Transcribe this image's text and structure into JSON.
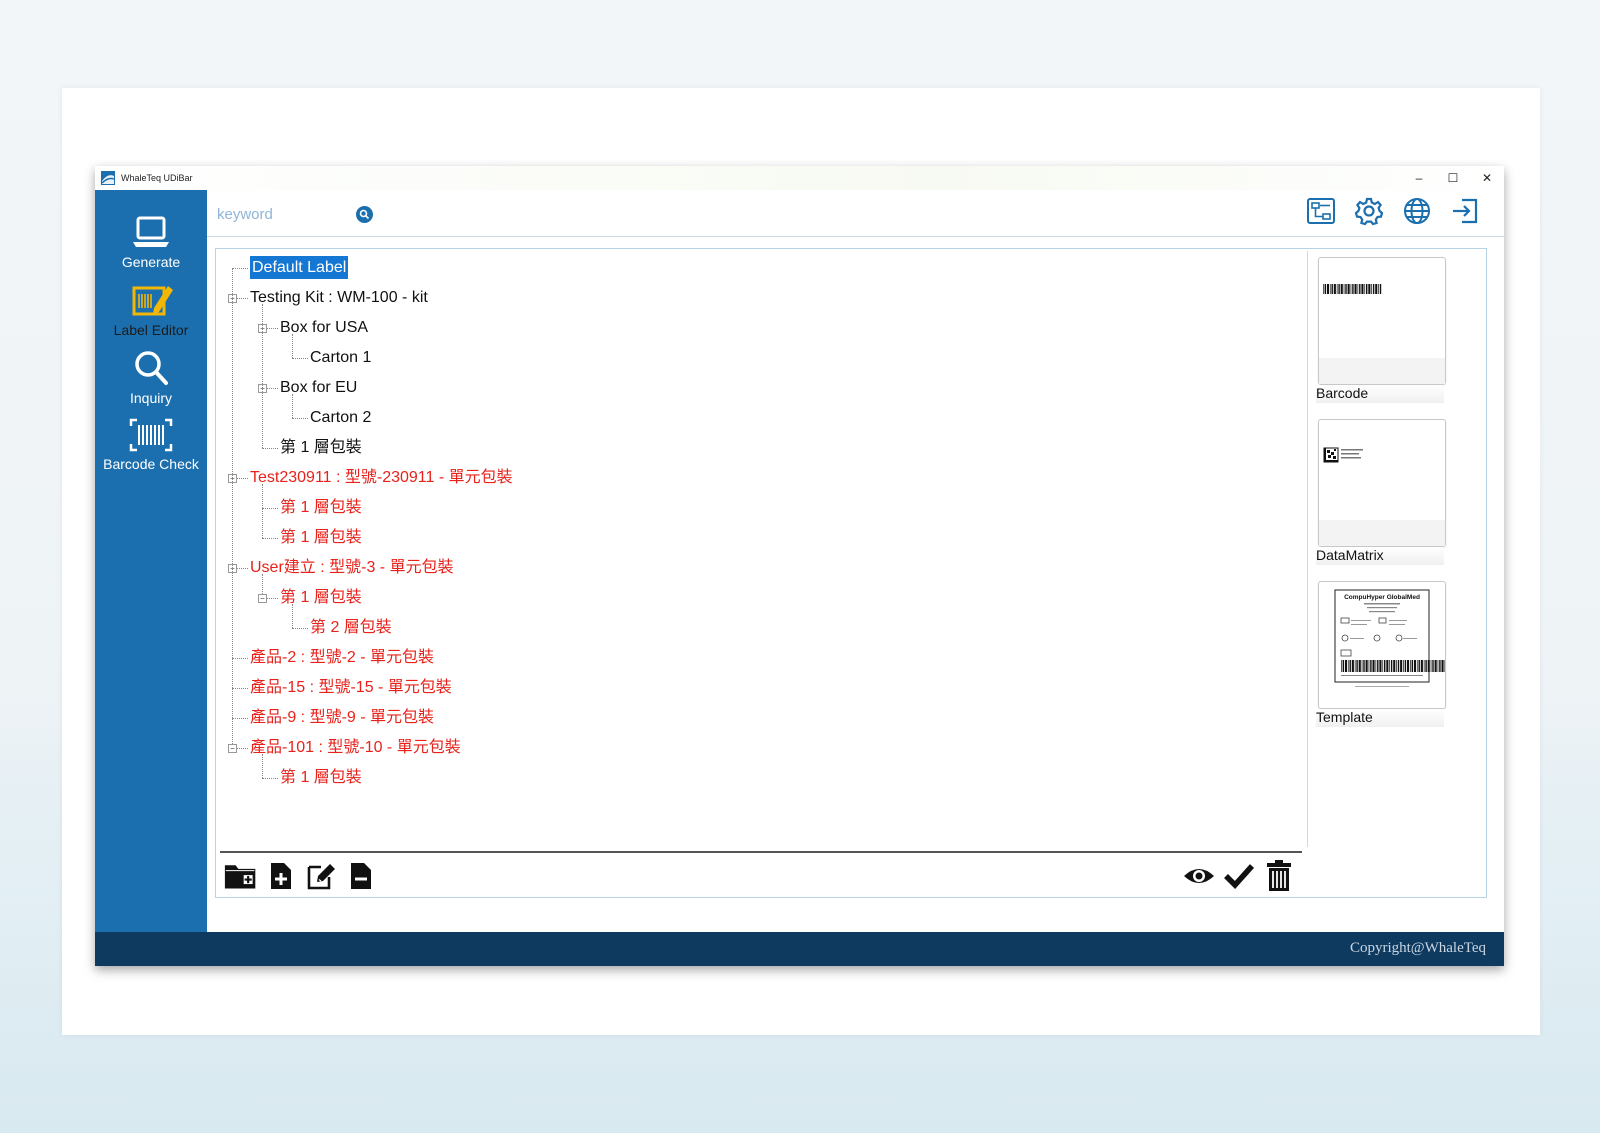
{
  "window": {
    "title": "WhaleTeq UDiBar",
    "controls": [
      "–",
      "☐",
      "✕"
    ]
  },
  "sidebar": {
    "items": [
      {
        "label": "Generate",
        "icon": "laptop-icon"
      },
      {
        "label": "Label Editor",
        "icon": "label-edit-icon"
      },
      {
        "label": "Inquiry",
        "icon": "magnifier-icon"
      },
      {
        "label": "Barcode Check",
        "icon": "barcode-scan-icon"
      }
    ]
  },
  "search": {
    "placeholder": "keyword"
  },
  "toolbar": {
    "icons": [
      "flow-chart-icon",
      "gear-icon",
      "globe-icon",
      "logout-icon"
    ]
  },
  "tree": {
    "nodes": [
      {
        "label": "Default Label",
        "level": 0,
        "color": "black",
        "selected": true
      },
      {
        "label": "Testing Kit : WM-100 - kit",
        "level": 0,
        "color": "black"
      },
      {
        "label": "Box for USA",
        "level": 1,
        "color": "black"
      },
      {
        "label": "Carton 1",
        "level": 2,
        "color": "black"
      },
      {
        "label": "Box for EU",
        "level": 1,
        "color": "black"
      },
      {
        "label": "Carton 2",
        "level": 2,
        "color": "black"
      },
      {
        "label": "第 1 層包裝",
        "level": 1,
        "color": "black"
      },
      {
        "label": "Test230911 : 型號-230911 - 單元包裝",
        "level": 0,
        "color": "red"
      },
      {
        "label": "第 1 層包裝",
        "level": 1,
        "color": "red"
      },
      {
        "label": "第 1 層包裝",
        "level": 1,
        "color": "red"
      },
      {
        "label": "User建立 : 型號-3 - 單元包裝",
        "level": 0,
        "color": "red"
      },
      {
        "label": "第 1 層包裝",
        "level": 1,
        "color": "red"
      },
      {
        "label": "第 2 層包裝",
        "level": 2,
        "color": "red"
      },
      {
        "label": "產品-2 : 型號-2 - 單元包裝",
        "level": 0,
        "color": "red"
      },
      {
        "label": "產品-15 : 型號-15 - 單元包裝",
        "level": 0,
        "color": "red"
      },
      {
        "label": "產品-9 : 型號-9 - 單元包裝",
        "level": 0,
        "color": "red"
      },
      {
        "label": "產品-101 : 型號-10 - 單元包裝",
        "level": 0,
        "color": "red"
      },
      {
        "label": "第 1 層包裝",
        "level": 1,
        "color": "red"
      }
    ]
  },
  "bottom_toolbar": {
    "left": [
      "add-folder-icon",
      "add-file-icon",
      "edit-icon",
      "remove-file-icon"
    ],
    "right": [
      "eye-icon",
      "checkmark-icon",
      "trash-icon"
    ]
  },
  "templates": [
    {
      "name": "Barcode"
    },
    {
      "name": "DataMatrix"
    },
    {
      "name": "Template",
      "preview_title": "CompuHyper GlobalMed"
    }
  ],
  "footer": {
    "text": "Copyright@WhaleTeq"
  },
  "colors": {
    "sidebar": "#1c6fae",
    "footer": "#0f3a60",
    "selected": "#1477d4",
    "red_text": "#e8221b"
  }
}
